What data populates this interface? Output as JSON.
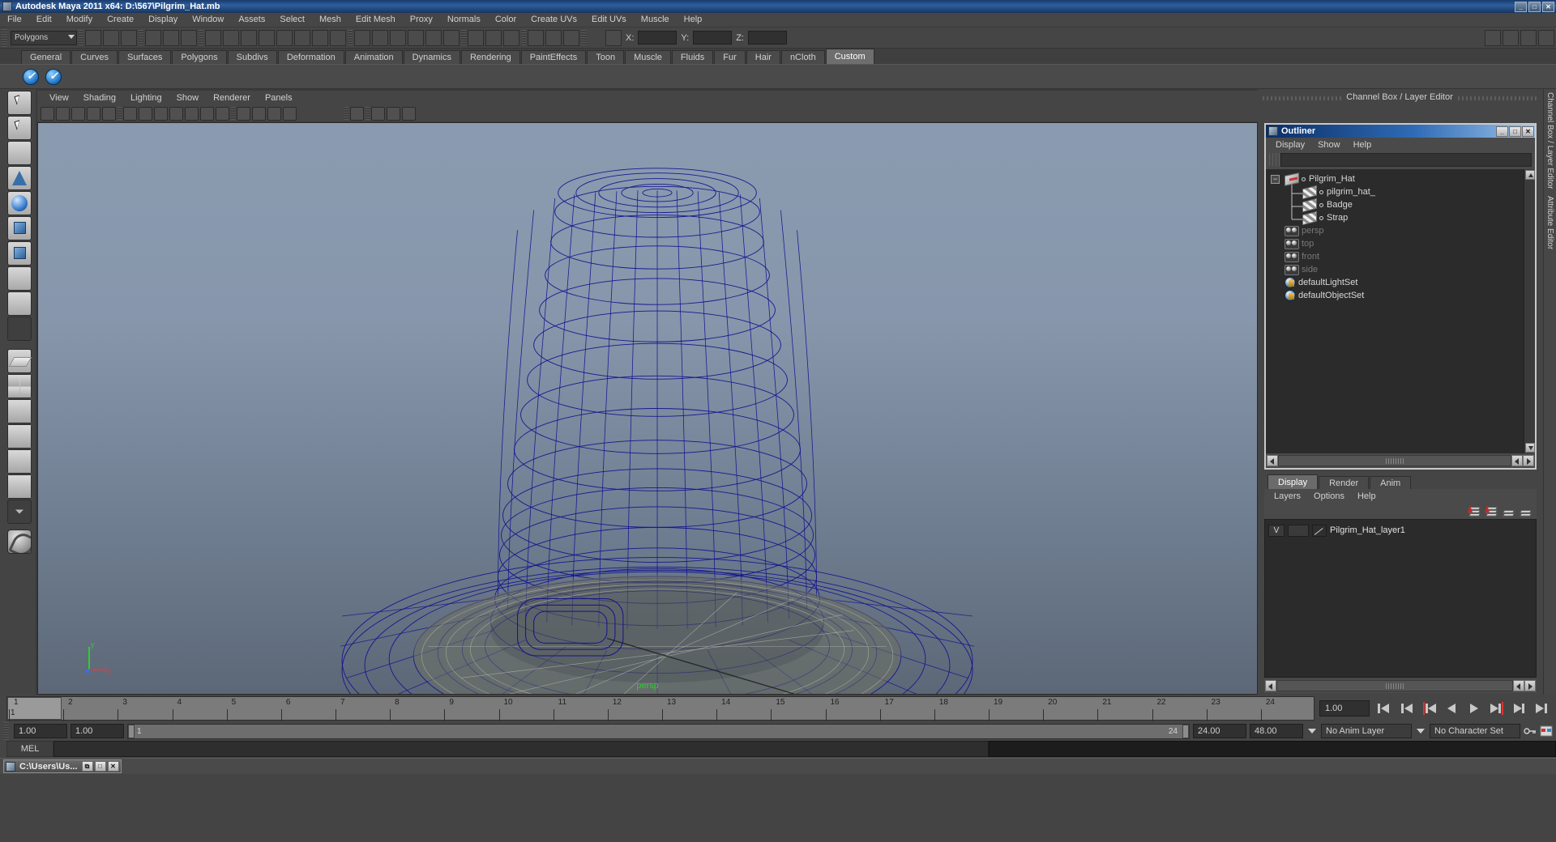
{
  "window": {
    "title": "Autodesk Maya 2011 x64: D:\\567\\Pilgrim_Hat.mb",
    "icon": "maya-icon",
    "buttons": [
      "_",
      "□",
      "✕"
    ]
  },
  "menubar": {
    "items": [
      "File",
      "Edit",
      "Modify",
      "Create",
      "Display",
      "Window",
      "Assets",
      "Select",
      "Mesh",
      "Edit Mesh",
      "Proxy",
      "Normals",
      "Color",
      "Create UVs",
      "Edit UVs",
      "Muscle",
      "Help"
    ]
  },
  "statusline": {
    "mode_selector": "Polygons",
    "coord_labels": {
      "x": "X:",
      "y": "Y:",
      "z": "Z:"
    },
    "coord_values": {
      "x": "",
      "y": "",
      "z": ""
    }
  },
  "shelf": {
    "tabs": [
      "General",
      "Curves",
      "Surfaces",
      "Polygons",
      "Subdivs",
      "Deformation",
      "Animation",
      "Dynamics",
      "Rendering",
      "PaintEffects",
      "Toon",
      "Muscle",
      "Fluids",
      "Fur",
      "Hair",
      "nCloth",
      "Custom"
    ],
    "active_tab": "Custom",
    "buttons": [
      "custom-shelf-button-1",
      "custom-shelf-button-2"
    ]
  },
  "toolbox": {
    "items": [
      "select-tool",
      "lasso-select-tool",
      "paint-select-tool",
      "move-tool",
      "rotate-tool",
      "scale-tool",
      "universal-manipulator-tool",
      "soft-modification-tool",
      "show-manipulator-tool",
      "last-tool-used"
    ],
    "layouts": [
      "single-perspective-view",
      "four-view",
      "two-panes-stacked",
      "outliner-persp",
      "persp-graph-editor",
      "hypershade-persp",
      "persp-graph-persp",
      "layout-more"
    ],
    "logo": "maya-logo"
  },
  "viewport": {
    "menus": [
      "View",
      "Shading",
      "Lighting",
      "Show",
      "Renderer",
      "Panels"
    ],
    "icon_row": [
      "select-camera-icon",
      "camera-attributes-icon",
      "bookmarks-icon",
      "image-plane-icon",
      "2d-pan-zoom-icon",
      "grid-toggle-icon",
      "film-gate-icon",
      "resolution-gate-icon",
      "gate-mask-icon",
      "wireframe-on-shaded-icon",
      "xray-icon",
      "texture-icon",
      "shaded-icon",
      "smooth-shade-icon",
      "flat-shade-icon",
      "wireframe-icon",
      "light-all-icon",
      "light-default-icon",
      "light-shadows-icon",
      "isolate-select-icon",
      "single-view-icon",
      "multi-view-icon",
      "share-icon"
    ],
    "camera_label": "persp",
    "axis": {
      "y": "y",
      "x": "x",
      "z": "z"
    },
    "object": "Pilgrim_Hat wireframe mesh"
  },
  "rightpanel": {
    "header": "Channel Box / Layer Editor",
    "side_strip": "Channel Box / Layer Editor",
    "side_strip_2": "Attribute Editor"
  },
  "outliner": {
    "title": "Outliner",
    "window_buttons": [
      "_",
      "□",
      "✕"
    ],
    "menus": [
      "Display",
      "Show",
      "Help"
    ],
    "search_value": "",
    "items": [
      {
        "label": "Pilgrim_Hat",
        "icon": "transform-icon",
        "depth": 0,
        "dim": false,
        "expandable": true
      },
      {
        "label": "pilgrim_hat_",
        "icon": "mesh-icon",
        "depth": 1,
        "dim": false,
        "expandable": false
      },
      {
        "label": "Badge",
        "icon": "mesh-icon",
        "depth": 1,
        "dim": false,
        "expandable": false
      },
      {
        "label": "Strap",
        "icon": "mesh-icon",
        "depth": 1,
        "dim": false,
        "expandable": false
      },
      {
        "label": "persp",
        "icon": "camera-icon",
        "depth": 0,
        "dim": true,
        "expandable": false
      },
      {
        "label": "top",
        "icon": "camera-icon",
        "depth": 0,
        "dim": true,
        "expandable": false
      },
      {
        "label": "front",
        "icon": "camera-icon",
        "depth": 0,
        "dim": true,
        "expandable": false
      },
      {
        "label": "side",
        "icon": "camera-icon",
        "depth": 0,
        "dim": true,
        "expandable": false
      },
      {
        "label": "defaultLightSet",
        "icon": "set-icon",
        "depth": 0,
        "dim": false,
        "expandable": false
      },
      {
        "label": "defaultObjectSet",
        "icon": "set-icon",
        "depth": 0,
        "dim": false,
        "expandable": false
      }
    ]
  },
  "layer_editor": {
    "tabs": [
      "Display",
      "Render",
      "Anim"
    ],
    "active_tab": "Display",
    "menus": [
      "Layers",
      "Options",
      "Help"
    ],
    "toolbar_icons": [
      "move-layer-up-icon",
      "move-layer-down-icon",
      "new-layer-icon",
      "new-layer-from-selected-icon"
    ],
    "layers": [
      {
        "visibility": "V",
        "playback": "",
        "name": "Pilgrim_Hat_layer1"
      }
    ]
  },
  "timeslider": {
    "current_frame": "1",
    "ticks": [
      "1",
      "2",
      "3",
      "4",
      "5",
      "6",
      "7",
      "8",
      "9",
      "10",
      "11",
      "12",
      "13",
      "14",
      "15",
      "16",
      "17",
      "18",
      "19",
      "20",
      "21",
      "22",
      "23",
      "24"
    ],
    "frame_field": "1.00",
    "playback_buttons": [
      "go-to-start",
      "step-back-frame",
      "step-back-key",
      "play-backwards",
      "play-forwards",
      "step-forward-key",
      "step-forward-frame",
      "go-to-end"
    ]
  },
  "rangeslider": {
    "anim_start": "1.00",
    "playback_start": "1.00",
    "range_left": "1",
    "range_right": "24",
    "playback_end": "24.00",
    "anim_end": "48.00",
    "anim_layer": "No Anim Layer",
    "character_set": "No Character Set",
    "icons": [
      "auto-key-icon",
      "animation-preferences-icon"
    ]
  },
  "commandline": {
    "language": "MEL",
    "input_value": "",
    "output_value": ""
  },
  "taskbar": {
    "item_label": "C:\\Users\\Us...",
    "buttons": [
      "⧉",
      "□",
      "✕"
    ]
  },
  "colors": {
    "title_blue": "#2e5f9e",
    "wireframe_blue": "#1a1ab0",
    "viewport_top": "#8a9bb0",
    "viewport_bottom": "#5c6877",
    "persp_green": "#2ecc2e",
    "panel_gray": "#454545"
  }
}
